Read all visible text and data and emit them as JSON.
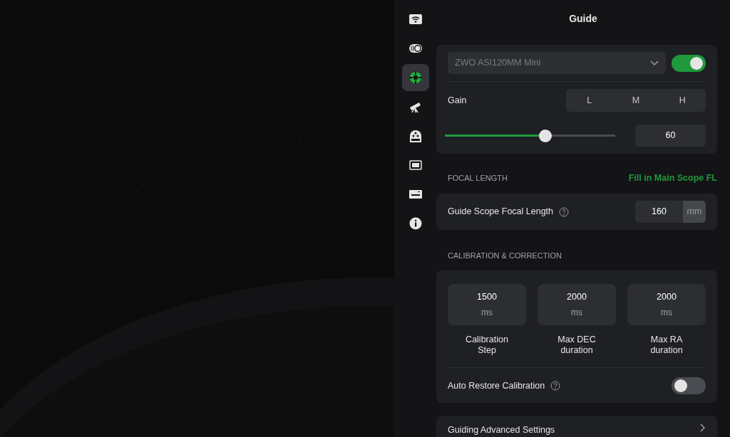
{
  "sidebar": {
    "items": [
      {
        "kind": "wifi",
        "selected": false
      },
      {
        "kind": "storage",
        "selected": false
      },
      {
        "kind": "guide",
        "selected": true
      },
      {
        "kind": "telescope",
        "selected": false
      },
      {
        "kind": "filter-wheel",
        "selected": false
      },
      {
        "kind": "focuser",
        "selected": false
      },
      {
        "kind": "memory",
        "selected": false
      },
      {
        "kind": "info",
        "selected": false
      }
    ]
  },
  "title": "Guide",
  "camera": {
    "value": "ZWO ASI120MM Mini",
    "on": true
  },
  "gain": {
    "label": "Gain",
    "presets": [
      {
        "label": "L",
        "selected": false
      },
      {
        "label": "M",
        "selected": false
      },
      {
        "label": "H",
        "selected": false
      }
    ],
    "level": 0.59,
    "value": "60"
  },
  "focal_length": {
    "heading": "FOCAL LENGTH",
    "link": "Fill in Main Scope FL",
    "label": "Guide Scope Focal Length",
    "value": "160",
    "unit": "mm"
  },
  "calibration": {
    "heading": "CALIBRATION & CORRECTION",
    "tiles": [
      {
        "value": "1500",
        "unit": "ms",
        "label": "Calibration Step"
      },
      {
        "value": "2000",
        "unit": "ms",
        "label": "Max DEC duration"
      },
      {
        "value": "2000",
        "unit": "ms",
        "label": "Max RA duration"
      }
    ],
    "auto_restore": {
      "label": "Auto Restore Calibration",
      "on": false
    }
  },
  "advanced": {
    "label": "Guiding Advanced Settings"
  }
}
